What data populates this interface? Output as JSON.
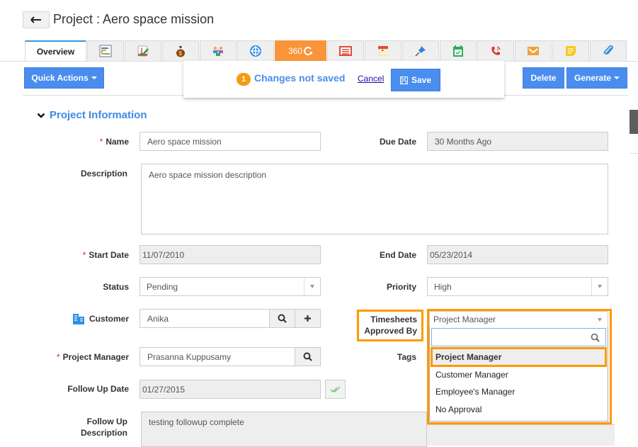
{
  "header": {
    "back_icon": "arrow-left-icon",
    "title": "Project : Aero space mission"
  },
  "tabs": [
    {
      "label": "Overview",
      "active": true
    },
    {
      "icon": "gantt-chart-icon"
    },
    {
      "icon": "task-checklist-icon"
    },
    {
      "icon": "money-bag-icon"
    },
    {
      "icon": "team-users-icon"
    },
    {
      "icon": "globe-target-icon"
    },
    {
      "label": "360",
      "icon": "refresh-360-icon"
    },
    {
      "icon": "newspaper-icon"
    },
    {
      "icon": "calendar-icon"
    },
    {
      "icon": "pin-icon"
    },
    {
      "icon": "calendar-check-icon"
    },
    {
      "icon": "phone-call-icon"
    },
    {
      "icon": "email-icon"
    },
    {
      "icon": "sticky-note-icon"
    },
    {
      "icon": "paperclip-icon"
    }
  ],
  "toolbar": {
    "quick_actions": "Quick Actions",
    "delete": "Delete",
    "generate": "Generate"
  },
  "unsaved": {
    "count": "1",
    "message": "Changes not saved",
    "cancel": "Cancel",
    "save": "Save"
  },
  "section": {
    "title": "Project Information"
  },
  "fields": {
    "name": {
      "label": "Name",
      "value": "Aero space mission",
      "required": true
    },
    "due_date": {
      "label": "Due Date",
      "value": "30 Months Ago"
    },
    "description": {
      "label": "Description",
      "value": "Aero space mission description"
    },
    "start_date": {
      "label": "Start Date",
      "value": "11/07/2010",
      "required": true
    },
    "end_date": {
      "label": "End Date",
      "value": "05/23/2014"
    },
    "status": {
      "label": "Status",
      "value": "Pending"
    },
    "priority": {
      "label": "Priority",
      "value": "High"
    },
    "customer": {
      "label": "Customer",
      "value": "Anika"
    },
    "timesheets": {
      "label_line1": "Timesheets",
      "label_line2": "Approved By",
      "value": "Project Manager"
    },
    "project_manager": {
      "label": "Project Manager",
      "value": "Prasanna Kuppusamy",
      "required": true
    },
    "tags": {
      "label": "Tags"
    },
    "follow_up_date": {
      "label": "Follow Up Date",
      "value": "01/27/2015"
    },
    "follow_up_description": {
      "label_line1": "Follow Up",
      "label_line2": "Description",
      "value": "testing followup complete"
    }
  },
  "dropdown": {
    "search_value": "",
    "options": [
      "Project Manager",
      "Customer Manager",
      "Employee's Manager",
      "No Approval"
    ],
    "selected": "Project Manager"
  },
  "colors": {
    "accent_blue": "#4a8def",
    "highlight_orange": "#ff9900",
    "badge_orange": "#f39c12",
    "tab_360_orange": "#f8953a",
    "required_red": "#d9232d"
  }
}
